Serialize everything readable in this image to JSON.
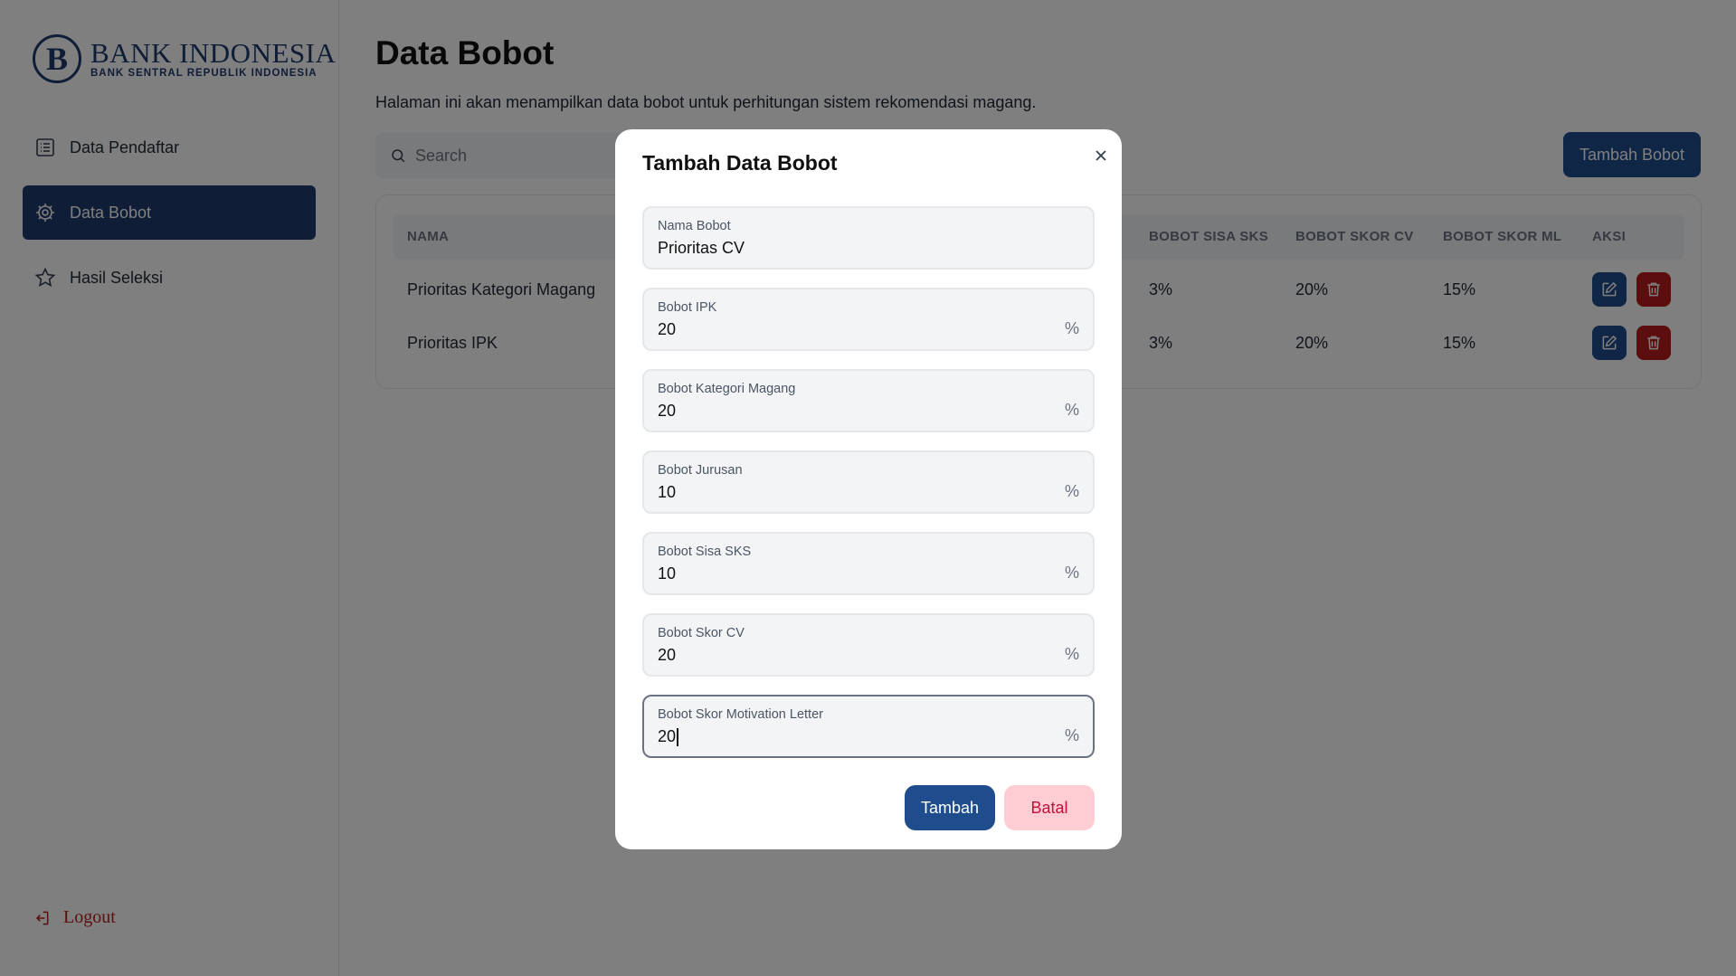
{
  "brand": {
    "logo_letter": "B",
    "title": "BANK INDONESIA",
    "subtitle": "BANK SENTRAL REPUBLIK INDONESIA",
    "color": "#1e3a6e"
  },
  "sidebar": {
    "items": [
      {
        "label": "Data Pendaftar",
        "icon": "list-icon",
        "active": false
      },
      {
        "label": "Data Bobot",
        "icon": "gear-icon",
        "active": true
      },
      {
        "label": "Hasil Seleksi",
        "icon": "star-icon",
        "active": false
      }
    ],
    "logout_label": "Logout"
  },
  "page": {
    "title": "Data Bobot",
    "description": "Halaman ini akan menampilkan data bobot untuk perhitungan sistem rekomendasi magang."
  },
  "search": {
    "placeholder": "Search",
    "value": ""
  },
  "toolbar": {
    "add_label": "Tambah Bobot"
  },
  "table": {
    "columns": [
      "NAMA",
      "BOBOT SISA SKS",
      "BOBOT SKOR CV",
      "BOBOT SKOR ML",
      "AKSI"
    ],
    "rows": [
      {
        "nama": "Prioritas Kategori Magang",
        "sisa_sks": "3%",
        "skor_cv": "20%",
        "skor_ml": "15%"
      },
      {
        "nama": "Prioritas IPK",
        "sisa_sks": "3%",
        "skor_cv": "20%",
        "skor_ml": "15%"
      }
    ]
  },
  "modal": {
    "title": "Tambah Data Bobot",
    "fields": [
      {
        "label": "Nama Bobot",
        "value": "Prioritas CV",
        "suffix": ""
      },
      {
        "label": "Bobot IPK",
        "value": "20",
        "suffix": "%"
      },
      {
        "label": "Bobot Kategori Magang",
        "value": "20",
        "suffix": "%"
      },
      {
        "label": "Bobot Jurusan",
        "value": "10",
        "suffix": "%"
      },
      {
        "label": "Bobot Sisa SKS",
        "value": "10",
        "suffix": "%"
      },
      {
        "label": "Bobot Skor CV",
        "value": "20",
        "suffix": "%"
      },
      {
        "label": "Bobot Skor Motivation Letter",
        "value": "20",
        "suffix": "%"
      }
    ],
    "submit_label": "Tambah",
    "cancel_label": "Batal"
  },
  "colors": {
    "primary": "#1e4c8c",
    "sidebar_active": "#1e3a6e",
    "danger": "#b91c1c",
    "cancel_bg": "#fecdd3",
    "cancel_text": "#be123c"
  }
}
